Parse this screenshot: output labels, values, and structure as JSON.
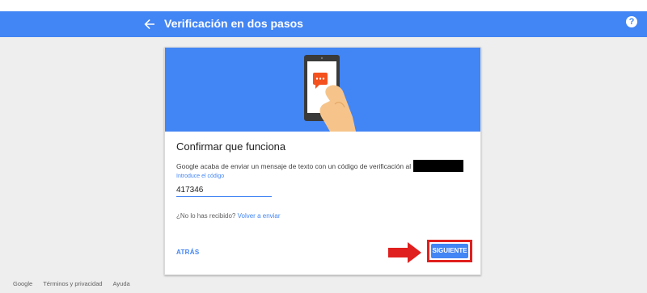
{
  "appbar": {
    "title": "Verificación en dos pasos",
    "back_icon": "arrow-back-icon",
    "help_icon": "help-icon",
    "help_glyph": "?",
    "color": "#4285f4"
  },
  "card": {
    "title": "Confirmar que funciona",
    "description": "Google acaba de enviar un mensaje de texto con un código de verificación al",
    "code_field": {
      "label": "Introduce el código",
      "value": "417346"
    },
    "resend_prompt": "¿No lo has recibido?",
    "resend_link": "Volver a enviar",
    "back_button": "ATRÁS",
    "next_button": "SIGUIENTE",
    "highlight_color": "#e0201e"
  },
  "footer": {
    "links": [
      "Google",
      "Términos y privacidad",
      "Ayuda"
    ]
  }
}
